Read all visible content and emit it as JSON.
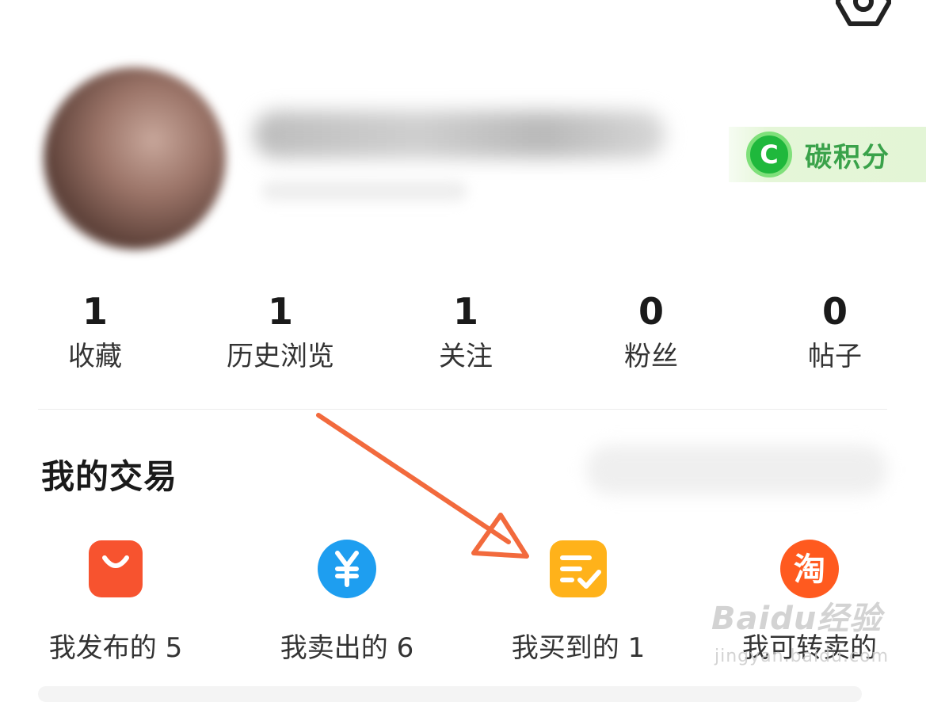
{
  "header": {
    "carbon_badge": {
      "icon_letter": "C",
      "label": "碳积分",
      "color": "#1fb83c"
    }
  },
  "stats": [
    {
      "count": "1",
      "label": "收藏"
    },
    {
      "count": "1",
      "label": "历史浏览"
    },
    {
      "count": "1",
      "label": "关注"
    },
    {
      "count": "0",
      "label": "粉丝"
    },
    {
      "count": "0",
      "label": "帖子"
    }
  ],
  "trades": {
    "title": "我的交易",
    "items": [
      {
        "label": "我发布的 5",
        "icon": "shopping-bag-icon",
        "color": "#f7532f"
      },
      {
        "label": "我卖出的 6",
        "icon": "yen-icon",
        "color": "#1e9ef0"
      },
      {
        "label": "我买到的 1",
        "icon": "checklist-icon",
        "color": "#ffb21a"
      },
      {
        "label": "我可转卖的",
        "icon": "taobao-tao-icon",
        "color": "#ff5a1f",
        "glyph": "淘"
      }
    ]
  },
  "annotation": {
    "arrow_color": "#f26a3d"
  },
  "watermark": {
    "brand": "Baidu经验",
    "url": "jingyan.baidu.com"
  }
}
